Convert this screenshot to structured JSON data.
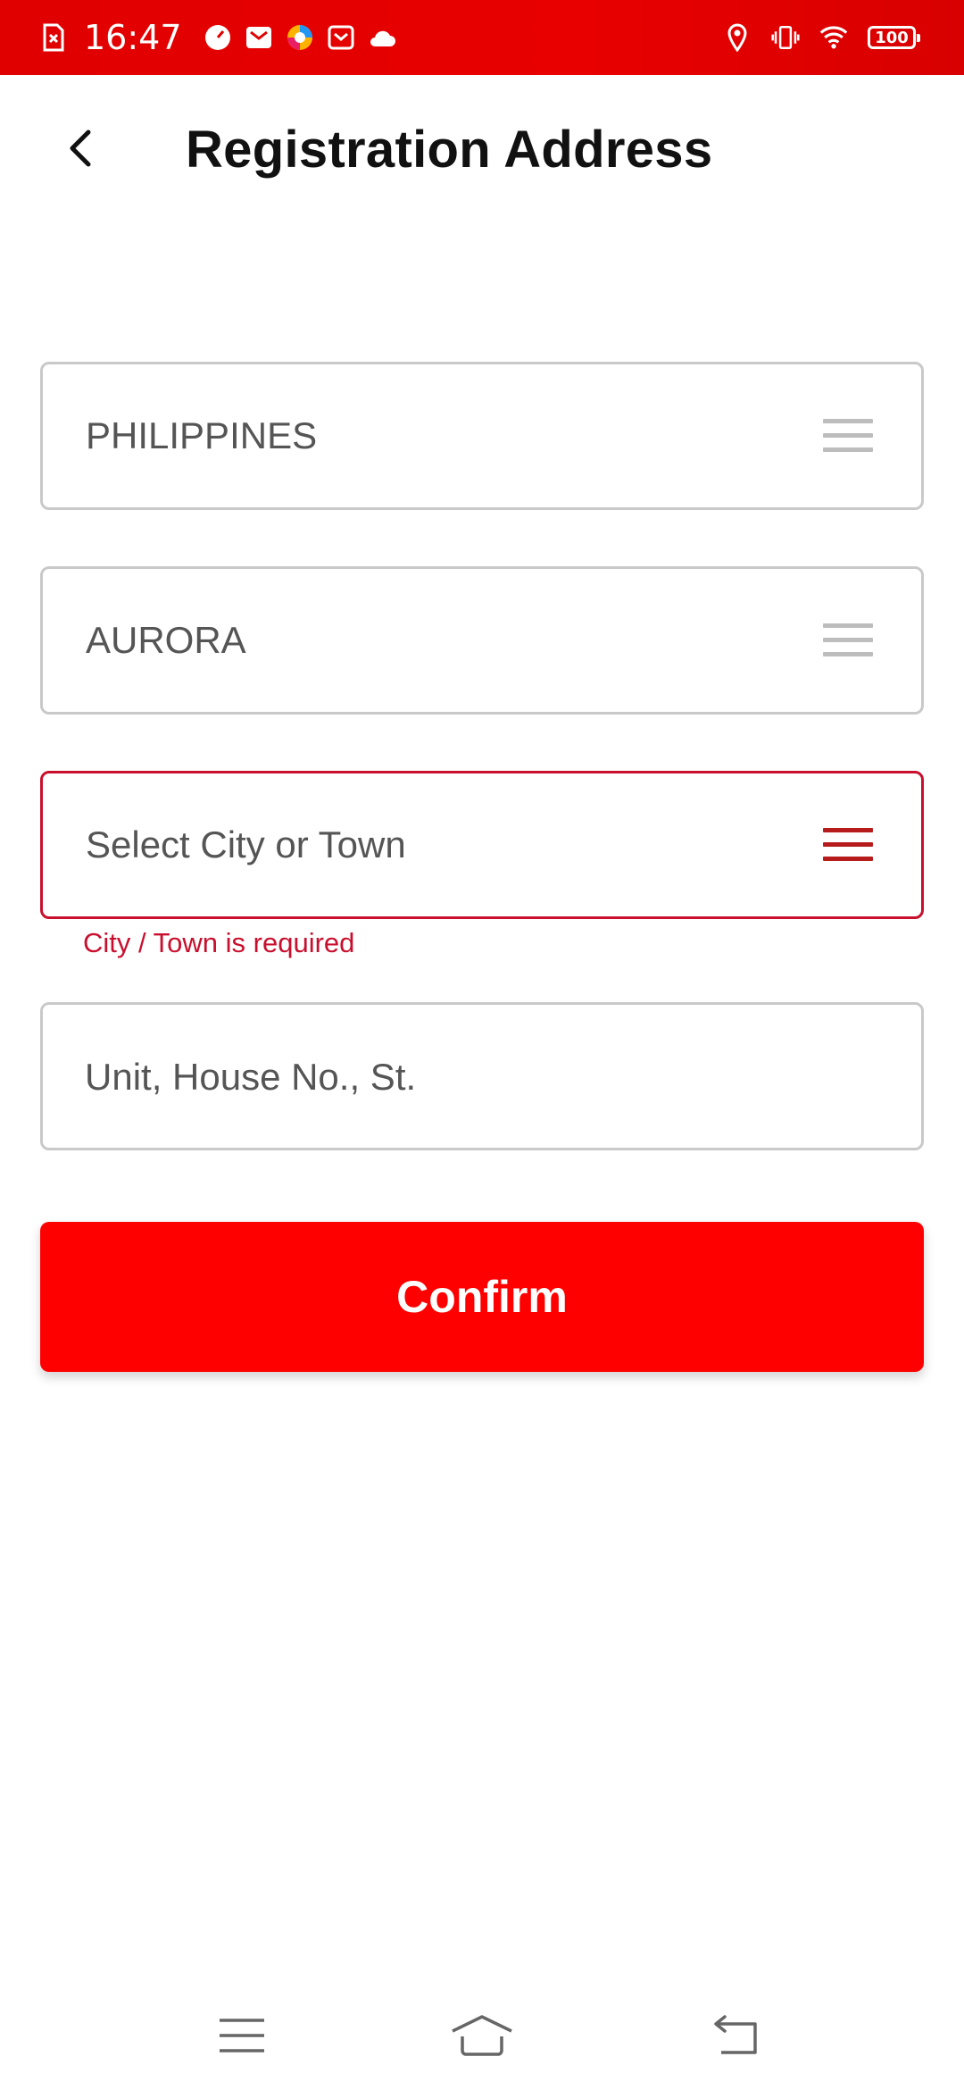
{
  "status_bar": {
    "time": "16:47",
    "left_icons": [
      "sim-error-icon",
      "speedometer-icon",
      "mail-icon",
      "browser-icon",
      "calendar-mail-icon",
      "cloud-icon"
    ],
    "right_icons": [
      "location-icon",
      "vibrate-icon",
      "wifi-icon"
    ],
    "battery": "100"
  },
  "header": {
    "title": "Registration Address",
    "back_icon": "chevron-left-icon"
  },
  "form": {
    "country": {
      "value": "PHILIPPINES"
    },
    "province": {
      "value": "AURORA"
    },
    "city": {
      "placeholder": "Select City or Town",
      "error": "City / Town is required"
    },
    "street": {
      "placeholder": "Unit, House No., St."
    },
    "confirm_label": "Confirm"
  },
  "colors": {
    "status_bar": "#e60000",
    "primary": "#ff0000",
    "error": "#c8102e",
    "border": "#c9c9c9"
  },
  "nav_bar": {
    "icons": [
      "menu-icon",
      "home-icon",
      "back-icon"
    ]
  }
}
